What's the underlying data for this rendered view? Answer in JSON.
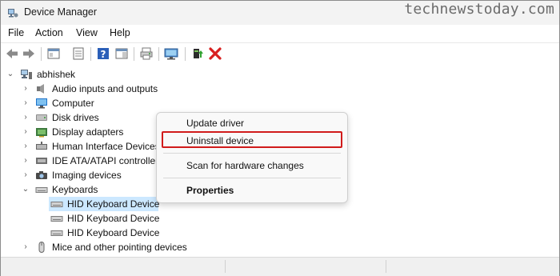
{
  "window": {
    "title": "Device Manager",
    "watermark": "technewstoday.com"
  },
  "menu": [
    "File",
    "Action",
    "View",
    "Help"
  ],
  "toolbar": {
    "buttons": [
      "back-arrow",
      "forward-arrow",
      "show-hide-console-tree",
      "properties",
      "help",
      "action-pane",
      "scan-hardware",
      "monitor",
      "update-driver",
      "uninstall"
    ]
  },
  "tree": {
    "root": "abhishek",
    "categories": [
      {
        "label": "Audio inputs and outputs",
        "icon": "speaker-icon",
        "expanded": false
      },
      {
        "label": "Computer",
        "icon": "computer-icon",
        "expanded": false
      },
      {
        "label": "Disk drives",
        "icon": "disk-icon",
        "expanded": false
      },
      {
        "label": "Display adapters",
        "icon": "display-adapter-icon",
        "expanded": false
      },
      {
        "label": "Human Interface Devices",
        "icon": "hid-icon",
        "expanded": false
      },
      {
        "label": "IDE ATA/ATAPI controllers",
        "icon": "ide-icon",
        "expanded": false
      },
      {
        "label": "Imaging devices",
        "icon": "camera-icon",
        "expanded": false
      },
      {
        "label": "Keyboards",
        "icon": "keyboard-icon",
        "expanded": true
      },
      {
        "label": "HID Keyboard Device",
        "icon": "keyboard-icon",
        "child": true,
        "selected": true
      },
      {
        "label": "HID Keyboard Device",
        "icon": "keyboard-icon",
        "child": true
      },
      {
        "label": "HID Keyboard Device",
        "icon": "keyboard-icon",
        "child": true
      },
      {
        "label": "Mice and other pointing devices",
        "icon": "mouse-icon",
        "expanded": false
      }
    ]
  },
  "context_menu": {
    "items": [
      "Update driver",
      "Uninstall device",
      "Scan for hardware changes",
      "Properties"
    ],
    "highlighted": "Uninstall device",
    "highlight_color": "#d11b1b"
  },
  "colors": {
    "selection": "#cce8ff",
    "titlebar": "#f3f3f3"
  }
}
